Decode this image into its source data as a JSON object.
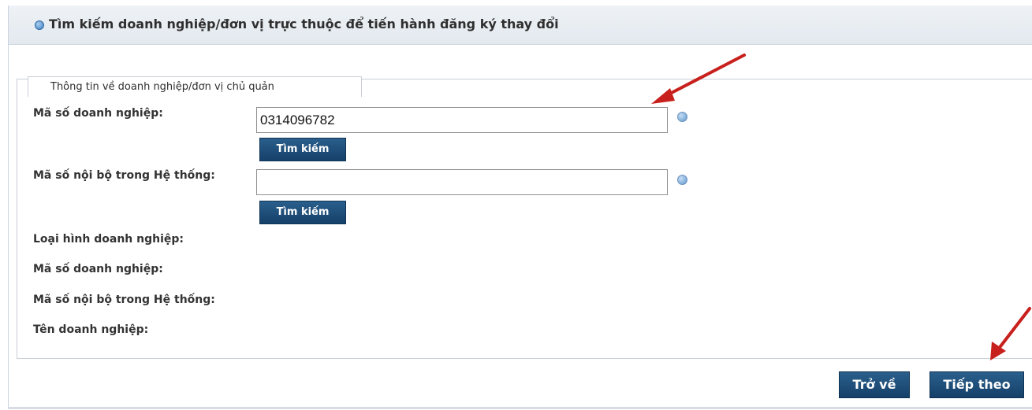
{
  "header": {
    "title": "Tìm kiếm doanh nghiệp/đơn vị trực thuộc để tiến hành đăng ký thay đổi"
  },
  "section": {
    "legend": "Thông tin về doanh nghiệp/đơn vị chủ quản"
  },
  "search_form": {
    "business_code_label": "Mã số doanh nghiệp:",
    "business_code_value": "0314096782",
    "search_button_1": "Tìm kiếm",
    "internal_code_label": "Mã số nội bộ trong Hệ thống:",
    "internal_code_value": "",
    "search_button_2": "Tìm kiếm"
  },
  "result_fields": {
    "business_type_label": "Loại hình doanh nghiệp:",
    "business_code_label": "Mã số doanh nghiệp:",
    "internal_code_label": "Mã số nội bộ trong Hệ thống:",
    "business_name_label": "Tên doanh nghiệp:"
  },
  "footer": {
    "back_button": "Trở về",
    "next_button": "Tiếp theo"
  },
  "colors": {
    "button": "#1b4a75",
    "header_bg": "#e6ecf2",
    "annotation_arrow": "#c8201c"
  },
  "icons": {
    "header_icon": "info-icon",
    "help_icon": "help-icon",
    "annotation": "red-arrow"
  }
}
